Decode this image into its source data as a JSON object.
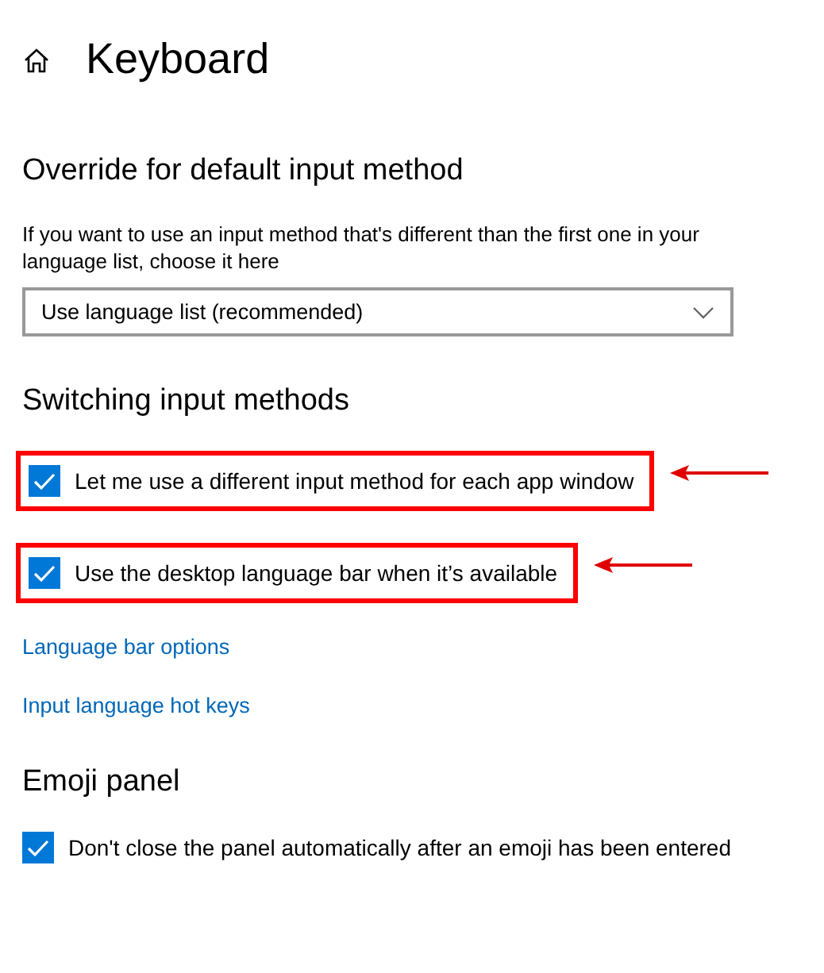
{
  "page": {
    "title": "Keyboard"
  },
  "sections": [
    {
      "heading": "Override for default input method",
      "description": "If you want to use an input method that's different than the first one in your language list, choose it here",
      "dropdown": {
        "value": "Use language list (recommended)"
      }
    },
    {
      "heading": "Switching input methods",
      "checkboxes": [
        {
          "label": "Let me use a different input method for each app window",
          "checked": true,
          "annotated": true
        },
        {
          "label": "Use the desktop language bar when it’s available",
          "checked": true,
          "annotated": true
        }
      ],
      "links": [
        "Language bar options",
        "Input language hot keys"
      ]
    },
    {
      "heading": "Emoji panel",
      "checkboxes": [
        {
          "label": "Don't close the panel automatically after an emoji has been entered",
          "checked": true,
          "annotated": false
        }
      ]
    }
  ]
}
